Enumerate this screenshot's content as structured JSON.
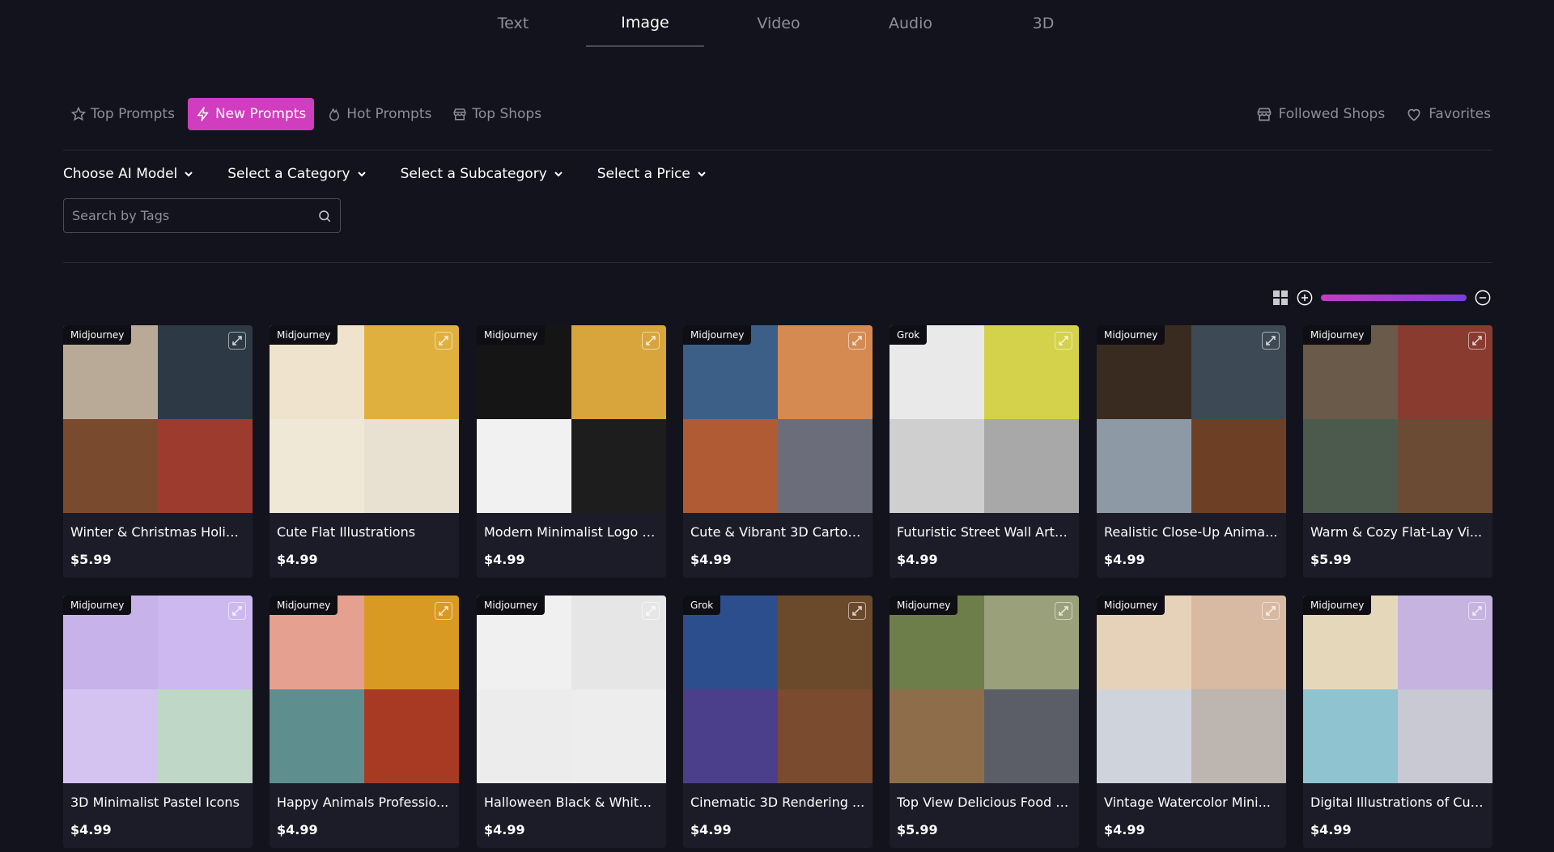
{
  "media_tabs": [
    {
      "label": "Text",
      "active": false
    },
    {
      "label": "Image",
      "active": true
    },
    {
      "label": "Video",
      "active": false
    },
    {
      "label": "Audio",
      "active": false
    },
    {
      "label": "3D",
      "active": false
    }
  ],
  "prompt_tabs": [
    {
      "label": "Top Prompts",
      "icon": "star-icon",
      "active": false
    },
    {
      "label": "New Prompts",
      "icon": "bolt-icon",
      "active": true
    },
    {
      "label": "Hot Prompts",
      "icon": "flame-icon",
      "active": false
    },
    {
      "label": "Top Shops",
      "icon": "shop-icon",
      "active": false
    }
  ],
  "right_links": [
    {
      "label": "Followed Shops",
      "icon": "shop-icon"
    },
    {
      "label": "Favorites",
      "icon": "heart-icon"
    }
  ],
  "filters": [
    {
      "label": "Choose AI Model"
    },
    {
      "label": "Select a Category"
    },
    {
      "label": "Select a Subcategory"
    },
    {
      "label": "Select a Price"
    }
  ],
  "search": {
    "placeholder": "Search by Tags",
    "value": ""
  },
  "colors": {
    "accent": "#d03dbe",
    "background": "#13131d",
    "card": "#1c1c28",
    "gradient_start": "#c73cc5",
    "gradient_end": "#7b3fd8"
  },
  "cards": [
    {
      "model": "Midjourney",
      "title": "Winter & Christmas Holid...",
      "price": "$5.99",
      "colors": [
        "#b9aa98",
        "#2d3a46",
        "#7a4a2f",
        "#9e3b2f"
      ]
    },
    {
      "model": "Midjourney",
      "title": "Cute Flat Illustrations",
      "price": "$4.99",
      "colors": [
        "#efe3cd",
        "#e0b03f",
        "#efe8d6",
        "#e8e1d2"
      ]
    },
    {
      "model": "Midjourney",
      "title": "Modern Minimalist Logo D...",
      "price": "$4.99",
      "colors": [
        "#151515",
        "#d7a53b",
        "#f1f1f1",
        "#1d1d1d"
      ]
    },
    {
      "model": "Midjourney",
      "title": "Cute & Vibrant 3D Cartoo...",
      "price": "$4.99",
      "colors": [
        "#3b5f86",
        "#d58a52",
        "#b05b33",
        "#6b6d7a"
      ]
    },
    {
      "model": "Grok",
      "title": "Futuristic Street Wall Art P...",
      "price": "$4.99",
      "colors": [
        "#e9e9e9",
        "#d4d24a",
        "#cfcfcf",
        "#a8a8a8"
      ]
    },
    {
      "model": "Midjourney",
      "title": "Realistic Close-Up Anima...",
      "price": "$4.99",
      "colors": [
        "#3a2b21",
        "#3d4a55",
        "#8d9aa6",
        "#6d4025"
      ]
    },
    {
      "model": "Midjourney",
      "title": "Warm & Cozy Flat-Lay Vi...",
      "price": "$5.99",
      "colors": [
        "#6a5a4a",
        "#8a3b30",
        "#4c5a4e",
        "#6b4b33"
      ]
    },
    {
      "model": "Midjourney",
      "title": "3D Minimalist Pastel Icons",
      "price": "$4.99",
      "colors": [
        "#c7b3ea",
        "#cdb9ef",
        "#d4c3f1",
        "#bfd7c6"
      ]
    },
    {
      "model": "Midjourney",
      "title": "Happy Animals Professio...",
      "price": "$4.99",
      "colors": [
        "#e6a08f",
        "#d99a24",
        "#5f8e8e",
        "#a83a24"
      ]
    },
    {
      "model": "Midjourney",
      "title": "Halloween Black & White ...",
      "price": "$4.99",
      "colors": [
        "#f0f0f0",
        "#e6e6e6",
        "#ececec",
        "#ededed"
      ]
    },
    {
      "model": "Grok",
      "title": "Cinematic 3D Rendering ...",
      "price": "$4.99",
      "colors": [
        "#2d4e8c",
        "#6b4a2c",
        "#4b3f8c",
        "#7a4b2e"
      ]
    },
    {
      "model": "Midjourney",
      "title": "Top View Delicious Food S...",
      "price": "$5.99",
      "colors": [
        "#6e7e4a",
        "#9aa07a",
        "#8e6e4a",
        "#5b5e66"
      ]
    },
    {
      "model": "Midjourney",
      "title": "Vintage Watercolor Mini...",
      "price": "$4.99",
      "colors": [
        "#e6d2b8",
        "#d8b9a2",
        "#cfd4dc",
        "#bdb5b0"
      ]
    },
    {
      "model": "Midjourney",
      "title": "Digital Illustrations of Cut...",
      "price": "$4.99",
      "colors": [
        "#e5d7b9",
        "#c6b3e0",
        "#8ec3cf",
        "#c8c9d2"
      ]
    }
  ]
}
